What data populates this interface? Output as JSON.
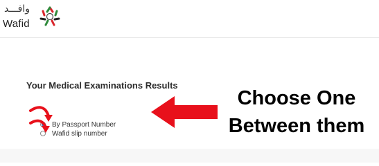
{
  "header": {
    "logo_arabic": "وافـــد",
    "logo_latin": "Wafid",
    "logo_mark_icon": "wafid-star-logo"
  },
  "main": {
    "title": "Your Medical Examinations Results",
    "options": [
      {
        "label": "By Passport Number",
        "checked": true
      },
      {
        "label": "Wafid slip number",
        "checked": false
      }
    ]
  },
  "annotation": {
    "line1": "Choose One",
    "line2": "Between them",
    "arrow_color": "#e8101b"
  },
  "colors": {
    "radio_selected": "#2a6fb8",
    "logo_red": "#d9262c",
    "logo_green": "#2f8a3b"
  }
}
